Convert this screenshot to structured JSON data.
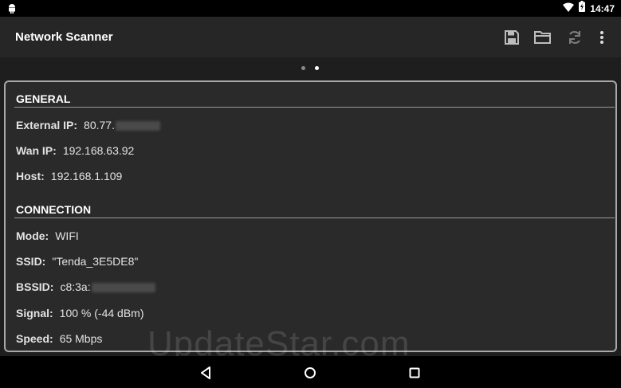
{
  "status_bar": {
    "time": "14:47",
    "icons": [
      "android-icon",
      "wifi-icon",
      "battery-charging-icon"
    ]
  },
  "action_bar": {
    "title": "Network Scanner",
    "actions": [
      "save-icon",
      "folder-open-icon",
      "refresh-icon",
      "overflow-menu-icon"
    ]
  },
  "pager": {
    "page_count": 2,
    "current_page": 2
  },
  "general": {
    "header": "GENERAL",
    "external_ip": {
      "label": "External IP:",
      "value": "80.77."
    },
    "wan_ip": {
      "label": "Wan IP:",
      "value": "192.168.63.92"
    },
    "host": {
      "label": "Host:",
      "value": "192.168.1.109"
    }
  },
  "connection": {
    "header": "CONNECTION",
    "mode": {
      "label": "Mode:",
      "value": "WIFI"
    },
    "ssid": {
      "label": "SSID:",
      "value": "\"Tenda_3E5DE8\""
    },
    "bssid": {
      "label": "BSSID:",
      "value": "c8:3a:"
    },
    "signal": {
      "label": "Signal:",
      "value": "100 % (-44 dBm)"
    },
    "speed": {
      "label": "Speed:",
      "value": "65 Mbps"
    }
  },
  "watermark": "UpdateStar.com",
  "nav_bar": [
    "back-icon",
    "home-icon",
    "recents-icon"
  ],
  "colors": {
    "background": "#1e1e1e",
    "card_border": "#a8a8a8",
    "text": "#e6e6e6"
  }
}
